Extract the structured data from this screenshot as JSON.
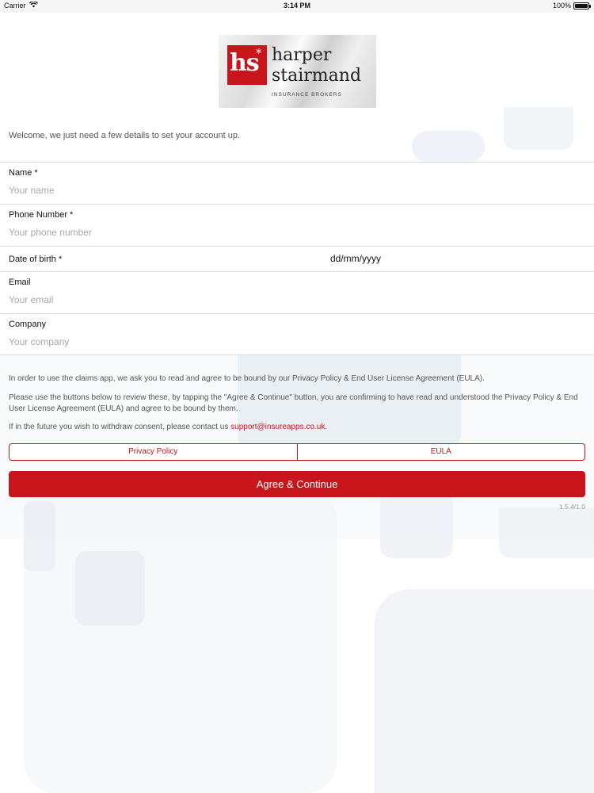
{
  "status_bar": {
    "carrier": "Carrier",
    "time": "3:14 PM",
    "battery": "100%",
    "battery_level": 1.0
  },
  "logo": {
    "mark": "hs",
    "star": "*",
    "word1": "harper",
    "word2": "stairmand",
    "subtitle": "INSURANCE BROKERS"
  },
  "welcome": "Welcome, we just need a few details to set your account up.",
  "form": {
    "name": {
      "label": "Name *",
      "placeholder": "Your name",
      "value": ""
    },
    "phone": {
      "label": "Phone Number *",
      "placeholder": "Your phone number",
      "value": ""
    },
    "dob": {
      "label": "Date of birth *",
      "value": "dd/mm/yyyy"
    },
    "email": {
      "label": "Email",
      "placeholder": "Your email",
      "value": ""
    },
    "company": {
      "label": "Company",
      "placeholder": "Your company",
      "value": ""
    }
  },
  "consent": {
    "p1": "In order to use the claims app, we ask you to read and agree to be bound by our Privacy Policy & End User License Agreement (EULA).",
    "p2": "Please use the buttons below to review these, by tapping the \"Agree & Continue\" button, you are confirming to have read and understood the Privacy Policy & End User License Agreement (EULA) and agree to be bound by them.",
    "p3_prefix": "If in the future you wish to withdraw consent, please contact us ",
    "support_email": "support@insureapps.co.uk",
    "p3_suffix": "."
  },
  "buttons": {
    "privacy_policy": "Privacy Policy",
    "eula": "EULA",
    "agree": "Agree & Continue"
  },
  "version": "1.5.4/1.0",
  "colors": {
    "accent": "#c8141b"
  }
}
